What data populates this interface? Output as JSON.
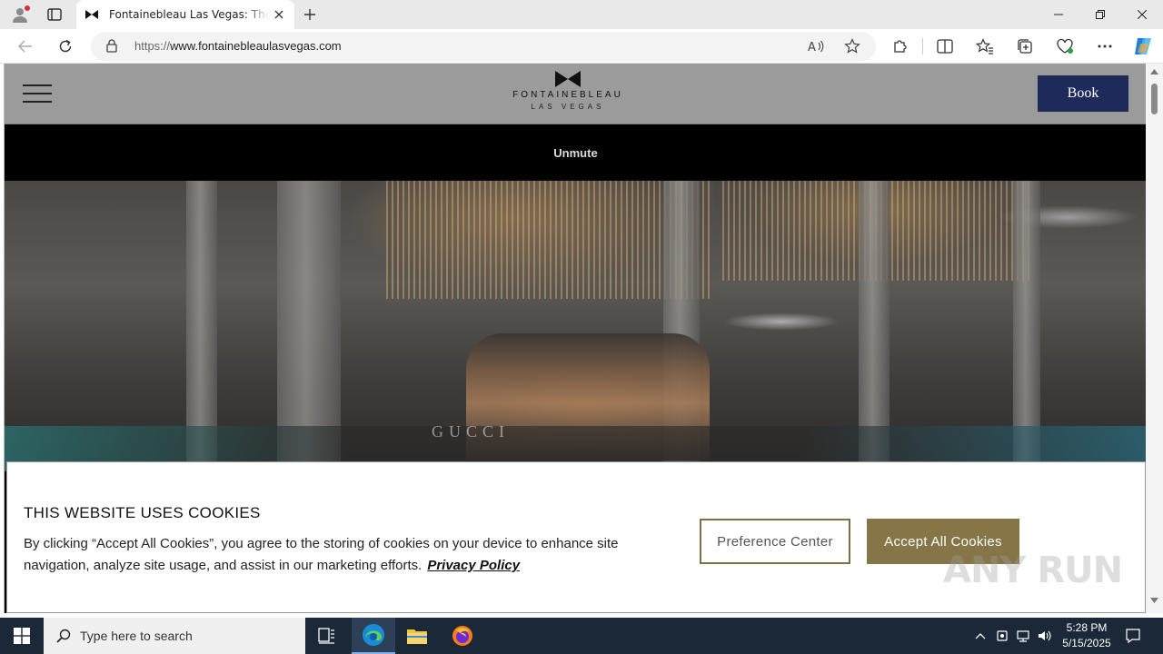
{
  "browser": {
    "tab_title": "Fontainebleau Las Vegas: The Best",
    "url_protocol": "https://",
    "url_host": "www.fontainebleaulasvegas.com"
  },
  "site": {
    "logo_name": "FONTAINEBLEAU",
    "logo_sub": "LAS VEGAS",
    "book_label": "Book",
    "unmute_label": "Unmute",
    "hero_sign": "GUCCI"
  },
  "cookie": {
    "heading": "THIS WEBSITE USES COOKIES",
    "body": "By clicking “Accept All Cookies”, you agree to the storing of cookies on your device to enhance site navigation, analyze site usage, and assist in our marketing efforts.",
    "privacy_link": "Privacy Policy",
    "preference_label": "Preference Center",
    "accept_label": "Accept All Cookies"
  },
  "watermark": "ANY RUN",
  "taskbar": {
    "search_placeholder": "Type here to search",
    "time": "5:28 PM",
    "date": "5/15/2025"
  },
  "colors": {
    "book_button": "#1e2a5a",
    "accept_button": "#857547",
    "preference_border": "#7d6f44",
    "taskbar": "#1b2838"
  }
}
